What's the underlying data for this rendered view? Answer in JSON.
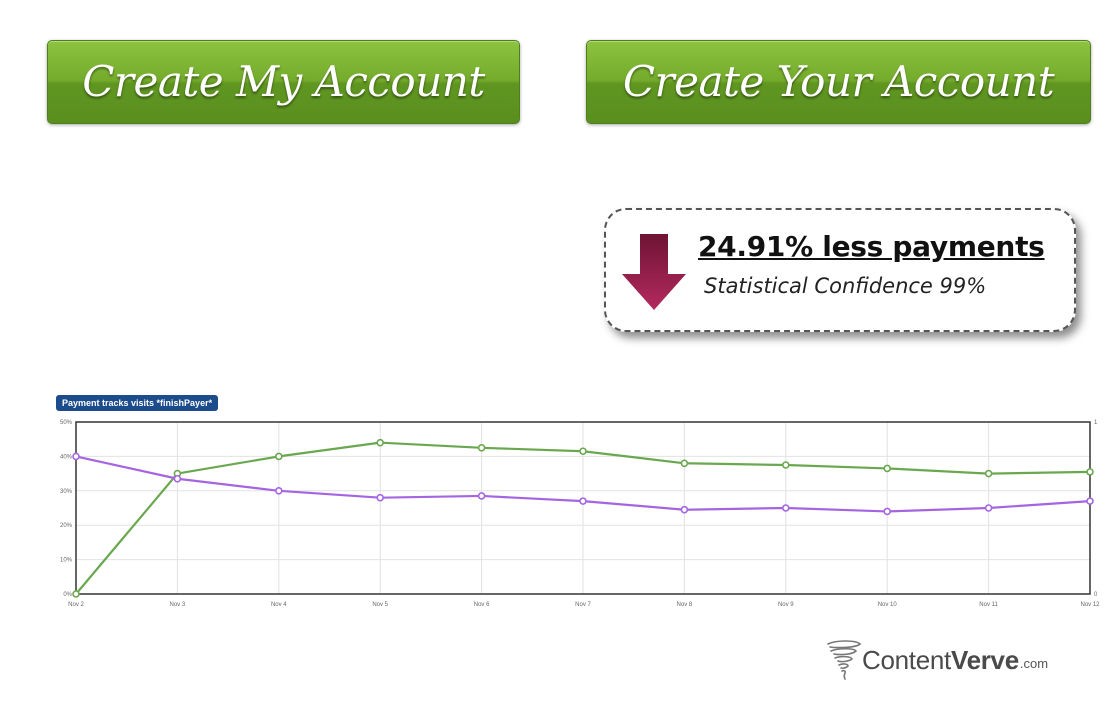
{
  "buttons": {
    "my_account": "Create My Account",
    "your_account": "Create Your Account",
    "color": "#6ea528"
  },
  "result": {
    "headline": "24.91% less payments",
    "confidence": "Statistical Confidence 99%",
    "arrow_color": "#8b1a45"
  },
  "chart_tag": "Payment tracks visits *finishPayer*",
  "brand": {
    "name_light": "Content",
    "name_bold": "Verve",
    "suffix": ".com",
    "icon": "tornado-icon"
  },
  "chart_data": {
    "type": "line",
    "categories": [
      "Nov 2",
      "Nov 3",
      "Nov 4",
      "Nov 5",
      "Nov 6",
      "Nov 7",
      "Nov 8",
      "Nov 9",
      "Nov 10",
      "Nov 11",
      "Nov 12"
    ],
    "series": [
      {
        "color": "#6aa84f",
        "values": [
          0,
          35,
          40,
          44,
          42.5,
          41.5,
          38,
          37.5,
          36.5,
          35,
          35.5
        ]
      },
      {
        "color": "#a565e0",
        "values": [
          40,
          33.5,
          30,
          28,
          28.5,
          27,
          24.5,
          25,
          24,
          25,
          27
        ]
      }
    ],
    "y_ticks": [
      "0%",
      "10%",
      "20%",
      "30%",
      "40%",
      "50%"
    ],
    "right_ticks": [
      "0",
      "1"
    ],
    "ylim": [
      0,
      50
    ],
    "grid": true
  }
}
